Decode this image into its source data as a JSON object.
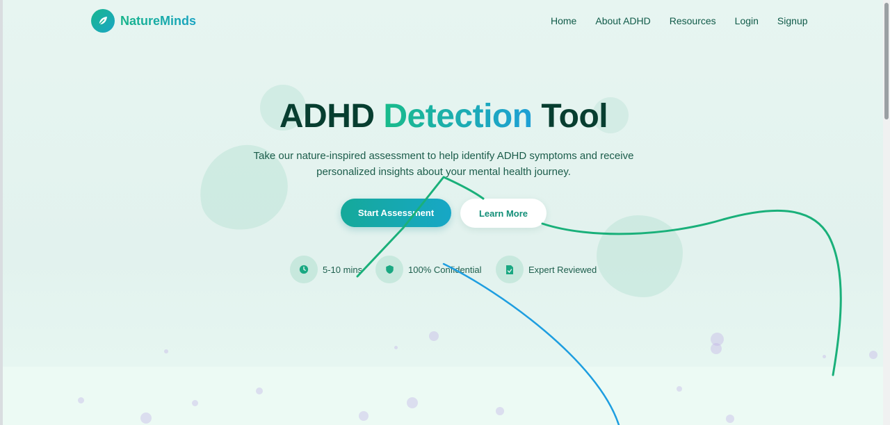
{
  "app": {
    "brand": "NatureMinds"
  },
  "nav": {
    "links": [
      "Home",
      "About ADHD",
      "Resources",
      "Login",
      "Signup"
    ]
  },
  "hero": {
    "title_part1": "ADHD",
    "title_accent": "Detection",
    "title_part3": "Tool",
    "subtitle_line1": "Take our nature-inspired assessment to help identify ADHD symptoms and receive",
    "subtitle_line2": "personalized insights about your mental health journey.",
    "primary_button": "Start Assessment",
    "secondary_button": "Learn More"
  },
  "features": [
    {
      "label": "5-10 mins",
      "icon": "clock-icon"
    },
    {
      "label": "100% Confidential",
      "icon": "shield-icon"
    },
    {
      "label": "Expert Reviewed",
      "icon": "document-check-icon"
    }
  ],
  "colors": {
    "brand_green": "#17b48a",
    "brand_blue": "#18a3c2",
    "heading_dark": "#073e30",
    "annotation_green": "#1ab07a",
    "annotation_blue": "#1e9ee0"
  }
}
